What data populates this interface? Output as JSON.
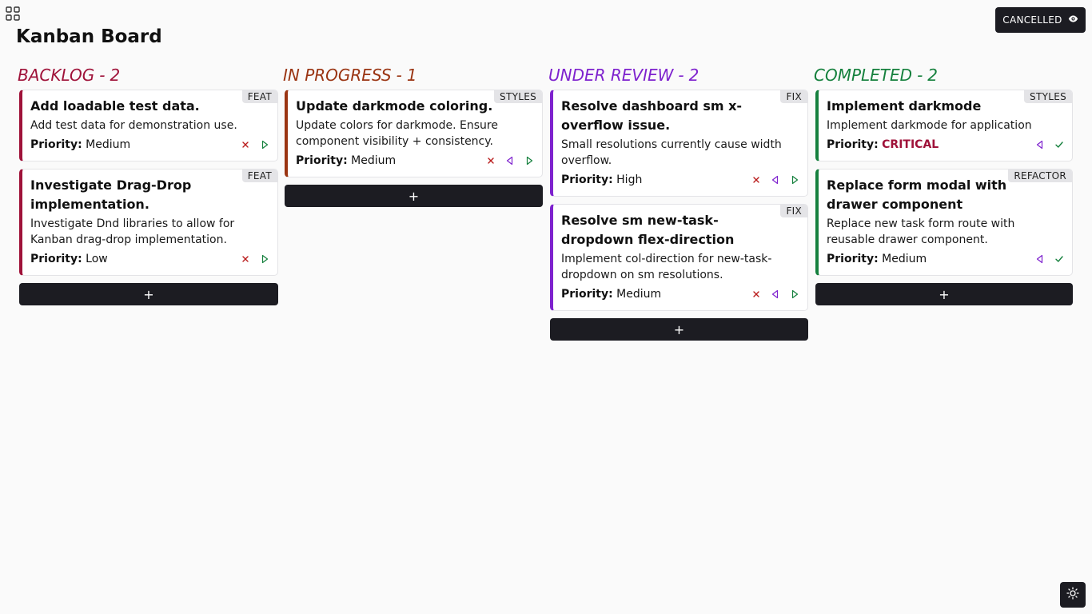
{
  "header": {
    "title": "Kanban Board",
    "cancelled_label": "CANCELLED",
    "apps_icon": "grid-icon",
    "view_icon": "eye-icon",
    "theme_icon": "sun-icon"
  },
  "colors": {
    "backlog": "#9f1239",
    "in_progress": "#9a3412",
    "under_review": "#7e22ce",
    "completed": "#15803d",
    "critical": "#9f1239",
    "dark": "#1c1c22"
  },
  "columns": [
    {
      "name": "BACKLOG",
      "separator": "-",
      "count": "2",
      "color": "#9f1239",
      "add_label": "+",
      "cards": [
        {
          "tag": "FEAT",
          "title": "Add loadable test data.",
          "description": "Add test data for demonstration use.",
          "priority_label": "Priority:",
          "priority": "Medium",
          "critical": false,
          "actions": [
            "x-icon",
            "next-icon"
          ]
        },
        {
          "tag": "FEAT",
          "title": "Investigate Drag-Drop implementation.",
          "description": "Investigate Dnd libraries to allow for Kanban drag-drop implementation.",
          "priority_label": "Priority:",
          "priority": "Low",
          "critical": false,
          "actions": [
            "x-icon",
            "next-icon"
          ]
        }
      ]
    },
    {
      "name": "IN PROGRESS",
      "separator": "-",
      "count": "1",
      "color": "#9a3412",
      "add_label": "+",
      "cards": [
        {
          "tag": "STYLES",
          "title": "Update darkmode coloring.",
          "description": "Update colors for darkmode. Ensure component visibility + consistency.",
          "priority_label": "Priority:",
          "priority": "Medium",
          "critical": false,
          "actions": [
            "x-icon",
            "prev-icon",
            "next-icon"
          ]
        }
      ]
    },
    {
      "name": "UNDER REVIEW",
      "separator": "-",
      "count": "2",
      "color": "#7e22ce",
      "add_label": "+",
      "cards": [
        {
          "tag": "FIX",
          "title": "Resolve dashboard sm x-overflow issue.",
          "description": "Small resolutions currently cause width overflow.",
          "priority_label": "Priority:",
          "priority": "High",
          "critical": false,
          "actions": [
            "x-icon",
            "prev-icon",
            "next-icon"
          ]
        },
        {
          "tag": "FIX",
          "title": "Resolve sm new-task-dropdown flex-direction",
          "description": "Implement col-direction for new-task-dropdown on sm resolutions.",
          "priority_label": "Priority:",
          "priority": "Medium",
          "critical": false,
          "actions": [
            "x-icon",
            "prev-icon",
            "next-icon"
          ]
        }
      ]
    },
    {
      "name": "COMPLETED",
      "separator": "-",
      "count": "2",
      "color": "#15803d",
      "add_label": "+",
      "cards": [
        {
          "tag": "STYLES",
          "title": "Implement darkmode",
          "description": "Implement darkmode for application",
          "priority_label": "Priority:",
          "priority": "CRITICAL",
          "critical": true,
          "actions": [
            "prev-icon",
            "check-icon"
          ]
        },
        {
          "tag": "REFACTOR",
          "title": "Replace form modal with drawer component",
          "description": "Replace new task form route with reusable drawer component.",
          "priority_label": "Priority:",
          "priority": "Medium",
          "critical": false,
          "actions": [
            "prev-icon",
            "check-icon"
          ]
        }
      ]
    }
  ]
}
